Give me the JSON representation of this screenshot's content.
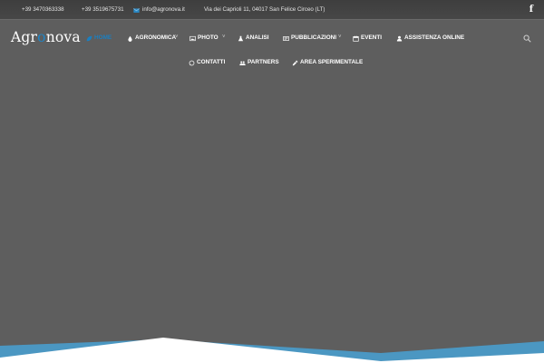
{
  "topbar": {
    "phone1": "+39 3470363338",
    "phone2": "+39 3519675731",
    "email": "info@agronova.it",
    "address": "Via dei Caprioli 11, 04017 San Felice Circeo (LT)",
    "social_icon": "facebook-icon",
    "social_label": "f"
  },
  "logo": {
    "part1": "Agr",
    "part2": "o",
    "part3": "nova"
  },
  "nav": {
    "home": "HOME",
    "agronomica": "AGRONOMICA",
    "photo": "PHOTO",
    "analisi": "ANALISI",
    "pubblicazioni": "PUBBLICAZIONI",
    "eventi": "EVENTI",
    "assistenza": "ASSISTENZA ONLINE",
    "contatti": "CONTATTI",
    "partners": "PARTNERS",
    "area": "AREA SPERIMENTALE",
    "caret": "˅"
  },
  "colors": {
    "accent": "#1b7fc0",
    "wave_blue": "#4b97c2",
    "background": "#5e5e5e"
  }
}
